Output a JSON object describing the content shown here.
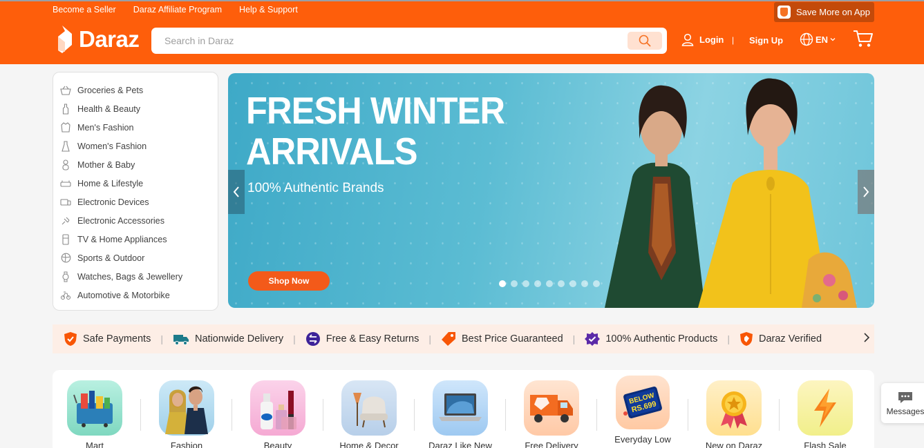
{
  "topnav": {
    "links": [
      "Become a Seller",
      "Daraz Affiliate Program",
      "Help & Support"
    ],
    "app_promo": "Save More on App"
  },
  "header": {
    "logo_text": "Daraz",
    "search_placeholder": "Search in Daraz",
    "login": "Login",
    "separator": "|",
    "signup": "Sign Up",
    "language": "EN",
    "brand_color": "#fe5e0b"
  },
  "categories": [
    {
      "label": "Groceries & Pets",
      "icon": "basket-icon"
    },
    {
      "label": "Health & Beauty",
      "icon": "bottle-icon"
    },
    {
      "label": "Men's Fashion",
      "icon": "shirt-icon"
    },
    {
      "label": "Women's Fashion",
      "icon": "dress-icon"
    },
    {
      "label": "Mother & Baby",
      "icon": "baby-icon"
    },
    {
      "label": "Home & Lifestyle",
      "icon": "sofa-icon"
    },
    {
      "label": "Electronic Devices",
      "icon": "devices-icon"
    },
    {
      "label": "Electronic Accessories",
      "icon": "plug-icon"
    },
    {
      "label": "TV & Home Appliances",
      "icon": "fridge-icon"
    },
    {
      "label": "Sports & Outdoor",
      "icon": "ball-icon"
    },
    {
      "label": "Watches, Bags & Jewellery",
      "icon": "watch-icon"
    },
    {
      "label": "Automotive & Motorbike",
      "icon": "car-icon"
    }
  ],
  "banner": {
    "title_line1": "FRESH WINTER",
    "title_line2": "ARRIVALS",
    "subtitle": "100% Authentic Brands",
    "cta": "Shop Now",
    "active_slide": 1,
    "slide_count": 9
  },
  "trust": [
    {
      "label": "Safe Payments",
      "icon": "shield-icon",
      "color": "#f85606"
    },
    {
      "label": "Nationwide Delivery",
      "icon": "truck-icon",
      "color": "#1d7b8a"
    },
    {
      "label": "Free & Easy Returns",
      "icon": "return-icon",
      "color": "#3d2399"
    },
    {
      "label": "Best Price Guaranteed",
      "icon": "price-tag-icon",
      "color": "#f85606"
    },
    {
      "label": "100% Authentic Products",
      "icon": "verified-badge-icon",
      "color": "#5b2aa8"
    },
    {
      "label": "Daraz Verified",
      "icon": "daraz-shield-icon",
      "color": "#f85606"
    }
  ],
  "quick_categories": [
    {
      "label": "Mart",
      "icon": "mart-icon"
    },
    {
      "label": "Fashion",
      "icon": "fashion-icon"
    },
    {
      "label": "Beauty",
      "icon": "beauty-icon"
    },
    {
      "label": "Home & Decor",
      "icon": "chair-icon"
    },
    {
      "label": "Daraz Like New",
      "icon": "laptop-icon"
    },
    {
      "label": "Free Delivery",
      "icon": "delivery-truck-icon"
    },
    {
      "label": "Everyday Low",
      "icon": "below-price-icon",
      "badge_line1": "BELOW",
      "badge_line2": "RS.699"
    },
    {
      "label": "New on Daraz",
      "icon": "medal-icon"
    },
    {
      "label": "Flash Sale",
      "icon": "lightning-icon"
    }
  ],
  "messages": {
    "label": "Messages"
  }
}
